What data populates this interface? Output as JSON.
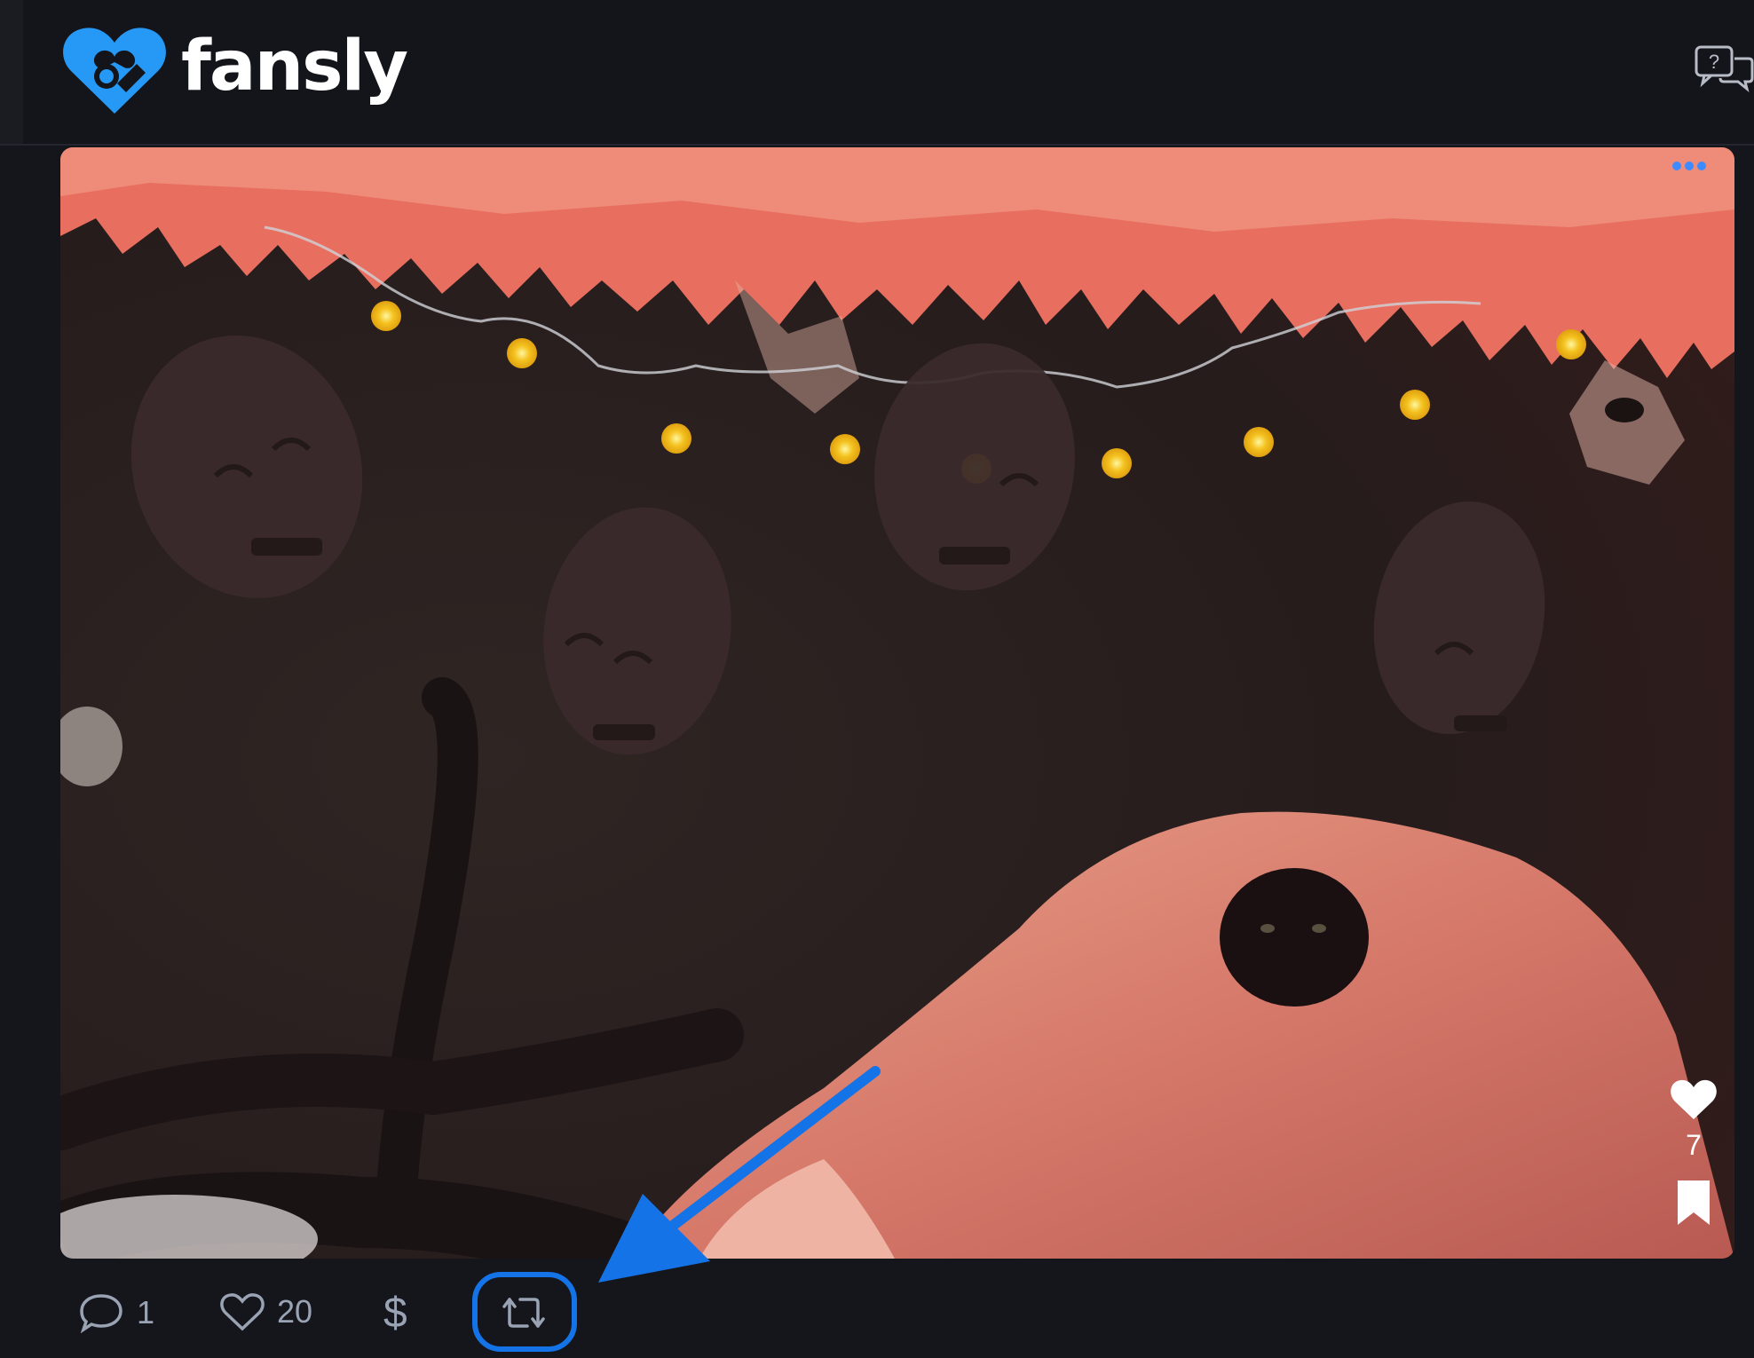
{
  "header": {
    "brand_name": "fansly",
    "brand_color": "#2699f7",
    "help_icon": "help-chat-icon"
  },
  "post": {
    "more_icon": "more-dots-icon",
    "image_description_icon": "halloween-photo",
    "side_like_count": "7",
    "side_like_icon": "heart-filled-icon",
    "side_bookmark_icon": "bookmark-icon"
  },
  "actions": {
    "comment_icon": "comment-icon",
    "comment_count": "1",
    "like_icon": "heart-outline-icon",
    "like_count": "20",
    "tip_icon": "dollar-icon",
    "tip_label": "$",
    "repost_icon": "repost-icon"
  },
  "annotation": {
    "arrow_color": "#1473e6",
    "highlight_color": "#1473e6"
  }
}
